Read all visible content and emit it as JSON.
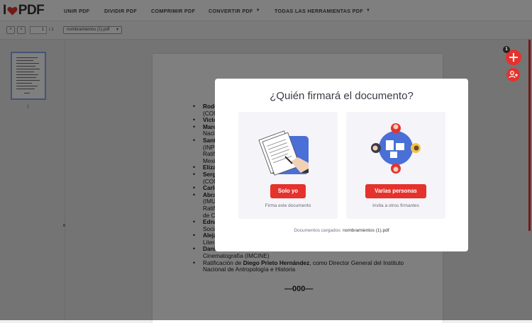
{
  "app": {
    "logo_text": "PDF",
    "logo_prefix": "I",
    "brand_color": "#e5322d"
  },
  "nav": {
    "items": [
      {
        "label": "UNIR PDF"
      },
      {
        "label": "DIVIDIR PDF"
      },
      {
        "label": "COMPRIMIR PDF"
      },
      {
        "label": "CONVERTIR PDF",
        "has_caret": true
      },
      {
        "label": "TODAS LAS HERRAMIENTAS PDF",
        "has_caret": true
      }
    ]
  },
  "toolbar": {
    "current_page": "1",
    "page_total": "/ 1",
    "file_selected": "nombramientos (1).pdf"
  },
  "sidebar": {
    "thumbnail_page": "1"
  },
  "document": {
    "items": [
      {
        "bold": "Rodo",
        "rest": "",
        "cont": "(CON"
      },
      {
        "bold": "Victo",
        "rest": "",
        "cont": ""
      },
      {
        "bold": "Marc",
        "rest": "",
        "cont": "Nacio"
      },
      {
        "bold": "Sant",
        "rest": "",
        "cont": "(INP"
      },
      {
        "bold": "",
        "rest": "Ratif",
        "cont": "Mexi"
      },
      {
        "bold": "Eliza",
        "rest": "",
        "cont": ""
      },
      {
        "bold": "Serg",
        "rest": "",
        "cont": "(CON"
      },
      {
        "bold": "Carlo",
        "rest": "",
        "cont": ""
      },
      {
        "bold": "Abra",
        "rest": "",
        "cont": "(IMU"
      },
      {
        "bold": "",
        "rest": "Ratif",
        "cont": "de C"
      },
      {
        "bold": "Edna",
        "rest": "",
        "cont": "Socia"
      },
      {
        "bold": "Aleja",
        "rest": "",
        "cont": "Litera"
      },
      {
        "bold": "Dani",
        "rest": "",
        "cont": "Cinematografía (IMCINE)"
      },
      {
        "bold": "",
        "rest": "Ratificación de ",
        "bold2": "Diego Prieto Hernández",
        "rest2": ", como Director General del Instituto",
        "cont": "Nacional de Antropología e Historia"
      }
    ],
    "end_mark": "—000—"
  },
  "fab": {
    "add_badge_count": "1",
    "add_icon": "plus-icon",
    "signers_icon": "add-signer-icon"
  },
  "modal": {
    "title": "¿Quién firmará el documento?",
    "option_solo": {
      "button_label": "Solo yo",
      "subtitle": "Firma este documento",
      "icon": "sign-document-illustration"
    },
    "option_multi": {
      "button_label": "Varias personas",
      "subtitle": "Invita a otros firmantes",
      "icon": "people-at-table-illustration"
    },
    "uploaded_label": "Documentos cargados:",
    "uploaded_file": "nombramientos (1).pdf"
  }
}
